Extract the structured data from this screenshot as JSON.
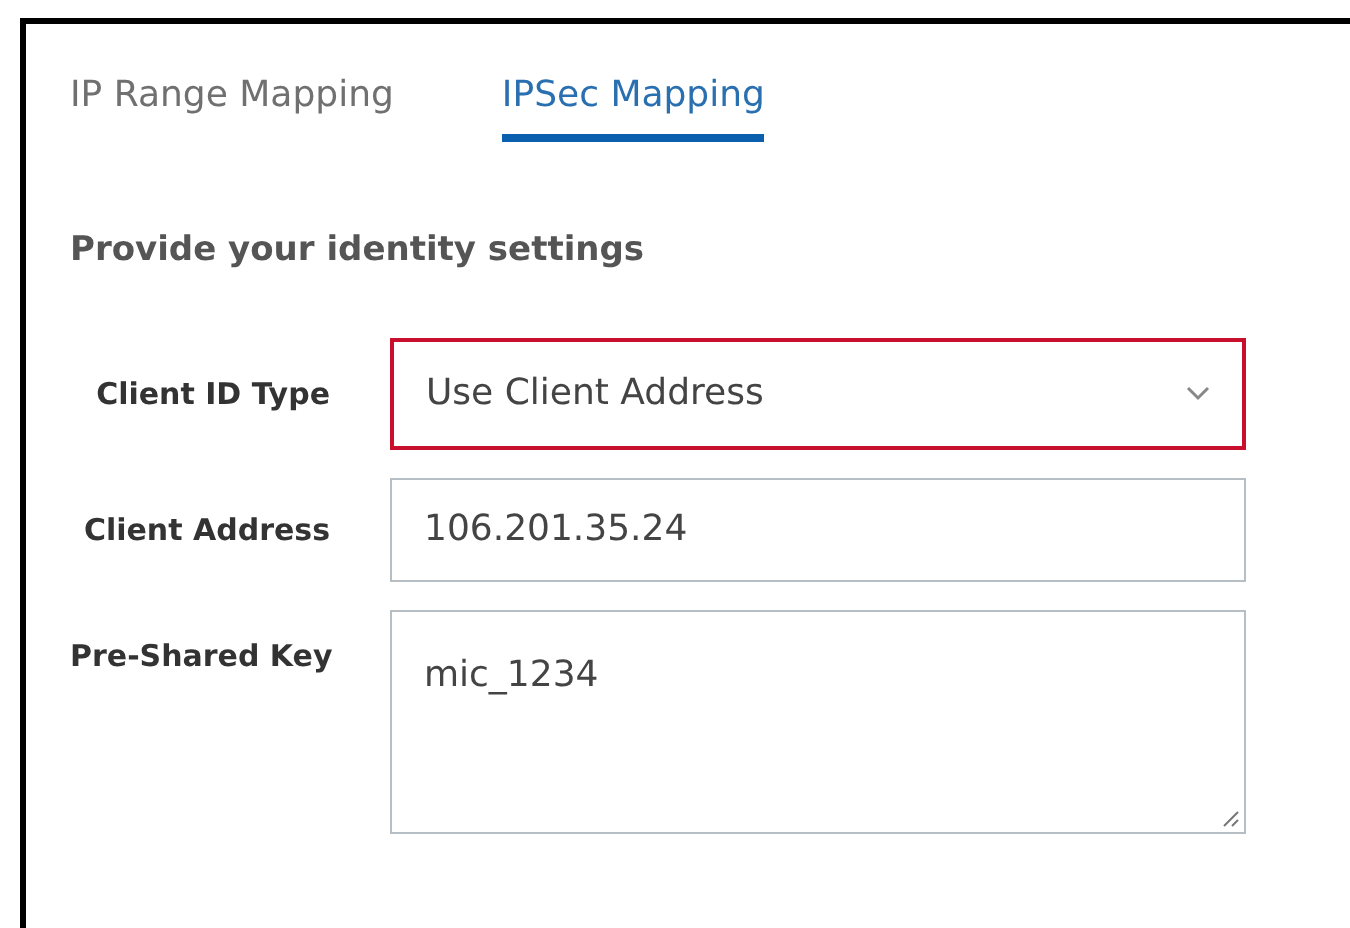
{
  "tabs": [
    {
      "label": "IP Range Mapping",
      "selected": false
    },
    {
      "label": "IPSec Mapping",
      "selected": true
    }
  ],
  "section_title": "Provide your identity settings",
  "fields": [
    {
      "label": "Client ID Type",
      "kind": "select",
      "value": "Use Client Address",
      "highlighted": true
    },
    {
      "label": "Client Address",
      "kind": "input",
      "value": "106.201.35.24",
      "highlighted": false
    },
    {
      "label": "Pre-Shared Key",
      "kind": "textarea",
      "value": "mic_1234",
      "highlighted": false
    }
  ]
}
